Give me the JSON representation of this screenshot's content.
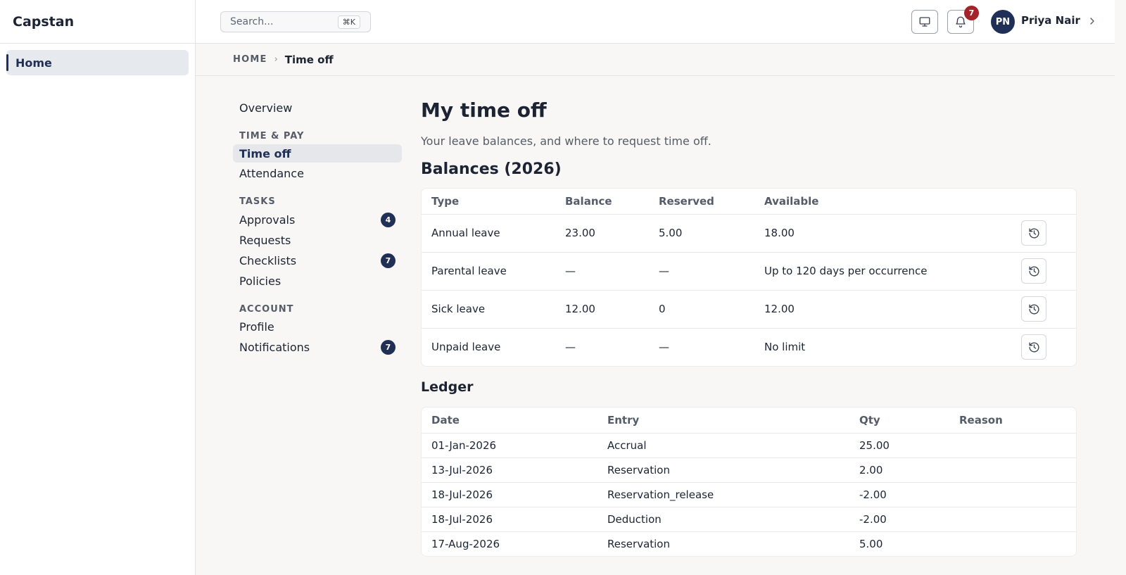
{
  "app": {
    "brand": "Capstan"
  },
  "sidebar": {
    "home_label": "Home"
  },
  "header": {
    "search_placeholder": "Search...",
    "search_shortcut": "⌘K",
    "notification_count": "7",
    "user_initials": "PN",
    "user_name": "Priya Nair"
  },
  "breadcrumb": {
    "home": "HOME",
    "current": "Time off"
  },
  "subnav": {
    "overview": "Overview",
    "groups": [
      {
        "label": "TIME & PAY",
        "items": [
          {
            "label": "Time off",
            "active": true
          },
          {
            "label": "Attendance"
          }
        ]
      },
      {
        "label": "TASKS",
        "items": [
          {
            "label": "Approvals",
            "count": "4"
          },
          {
            "label": "Requests"
          },
          {
            "label": "Checklists",
            "count": "7"
          },
          {
            "label": "Policies"
          }
        ]
      },
      {
        "label": "ACCOUNT",
        "items": [
          {
            "label": "Profile"
          },
          {
            "label": "Notifications",
            "count": "7"
          }
        ]
      }
    ]
  },
  "main": {
    "title": "My time off",
    "subtitle": "Your leave balances, and where to request time off.",
    "balances": {
      "title": "Balances (2026)",
      "columns": [
        "Type",
        "Balance",
        "Reserved",
        "Available"
      ],
      "rows": [
        {
          "type": "Annual leave",
          "balance": "23.00",
          "reserved": "5.00",
          "available": "18.00"
        },
        {
          "type": "Parental leave",
          "balance": "—",
          "reserved": "—",
          "available": "Up to 120 days per occurrence"
        },
        {
          "type": "Sick leave",
          "balance": "12.00",
          "reserved": "0",
          "available": "12.00"
        },
        {
          "type": "Unpaid leave",
          "balance": "—",
          "reserved": "—",
          "available": "No limit"
        }
      ]
    },
    "ledger": {
      "title": "Ledger",
      "columns": [
        "Date",
        "Entry",
        "Qty",
        "Reason"
      ],
      "rows": [
        {
          "date": "01-Jan-2026",
          "entry": "Accrual",
          "qty": "25.00",
          "reason": ""
        },
        {
          "date": "13-Jul-2026",
          "entry": "Reservation",
          "qty": "2.00",
          "reason": ""
        },
        {
          "date": "18-Jul-2026",
          "entry": "Reservation_release",
          "qty": "-2.00",
          "reason": ""
        },
        {
          "date": "18-Jul-2026",
          "entry": "Deduction",
          "qty": "-2.00",
          "reason": ""
        },
        {
          "date": "17-Aug-2026",
          "entry": "Reservation",
          "qty": "5.00",
          "reason": ""
        }
      ]
    }
  },
  "icons": {
    "monitor": "monitor-icon",
    "bell": "bell-icon",
    "history": "history-icon",
    "chevron": "chevron-right-icon"
  },
  "colors": {
    "navy": "#1f2f55",
    "badge_red": "#a3232b"
  }
}
